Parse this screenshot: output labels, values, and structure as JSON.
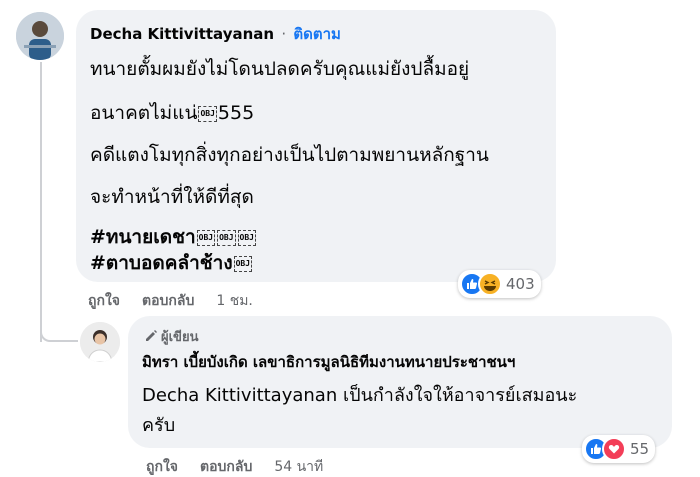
{
  "comment": {
    "author": "Decha Kittivittayanan",
    "separator": "·",
    "follow_label": "ติดตาม",
    "lines": [
      "ทนายตั้มผมยังไม่โดนปลดครับคุณแม่ยังปลื้มอยู่",
      "อนาคตไม่แน่",
      "555",
      "คดีแตงโมทุกสิ่งทุกอย่างเป็นไปตามพยานหลักฐาน",
      "จะทำหน้าที่ให้ดีที่สุด",
      "#ทนายเดชา",
      "#ตาบอดคลำช้าง"
    ],
    "obj_placeholder": "OBJ",
    "reaction_count": "403",
    "reaction_icons": [
      "like-icon",
      "haha-icon"
    ],
    "actions": {
      "like": "ถูกใจ",
      "reply": "ตอบกลับ",
      "time": "1 ชม."
    }
  },
  "reply": {
    "badge": "ผู้เขียน",
    "author": "มิทรา เบี้ยบังเกิด เลขาธิการมูลนิธิทีมงานทนายประชาชนฯ",
    "mention": "Decha Kittivittayanan",
    "text_1": "เป็นกำลังใจให้อาจารย์เสมอนะ",
    "text_2": "ครับ",
    "reaction_count": "55",
    "reaction_icons": [
      "like-icon",
      "love-icon"
    ],
    "actions": {
      "like": "ถูกใจ",
      "reply": "ตอบกลับ",
      "time": "54 นาที"
    }
  },
  "colors": {
    "link": "#1877f2",
    "bubble": "#f0f2f5",
    "meta": "#65676b"
  }
}
